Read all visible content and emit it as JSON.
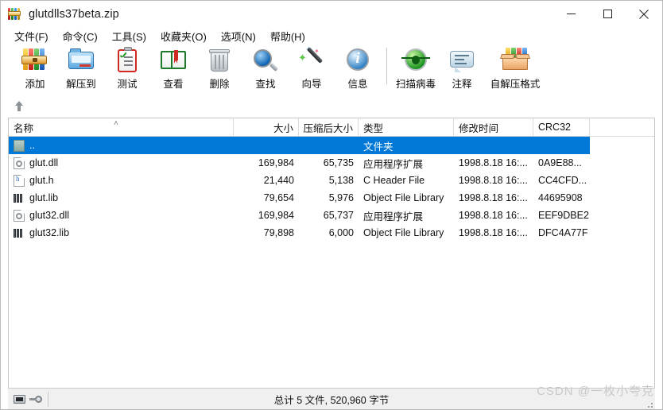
{
  "window": {
    "title": "glutdlls37beta.zip",
    "app_icon": "winrar-books-icon",
    "minimize_label": "─",
    "maximize_label": "□",
    "close_label": "✕"
  },
  "menubar": {
    "items": [
      {
        "label": "文件(F)",
        "name": "menu-file"
      },
      {
        "label": "命令(C)",
        "name": "menu-commands"
      },
      {
        "label": "工具(S)",
        "name": "menu-tools"
      },
      {
        "label": "收藏夹(O)",
        "name": "menu-favorites"
      },
      {
        "label": "选项(N)",
        "name": "menu-options"
      },
      {
        "label": "帮助(H)",
        "name": "menu-help"
      }
    ]
  },
  "toolbar": {
    "buttons": [
      {
        "label": "添加",
        "icon": "archive-add-icon"
      },
      {
        "label": "解压到",
        "icon": "extract-folder-icon"
      },
      {
        "label": "测试",
        "icon": "clipboard-test-icon"
      },
      {
        "label": "查看",
        "icon": "open-book-view-icon"
      },
      {
        "label": "删除",
        "icon": "trash-delete-icon"
      },
      {
        "label": "查找",
        "icon": "magnifier-find-icon"
      },
      {
        "label": "向导",
        "icon": "magic-wand-wizard-icon"
      },
      {
        "label": "信息",
        "icon": "info-circle-icon"
      },
      {
        "label": "扫描病毒",
        "icon": "virus-scan-icon"
      },
      {
        "label": "注释",
        "icon": "comment-bubble-icon"
      },
      {
        "label": "自解压格式",
        "icon": "sfx-box-icon"
      }
    ]
  },
  "navbar": {
    "up_icon": "up-arrow-icon"
  },
  "filelist": {
    "sort_indicator": "˄",
    "columns": [
      {
        "label": "名称",
        "name": "column-name",
        "align": "left"
      },
      {
        "label": "大小",
        "name": "column-size",
        "align": "right"
      },
      {
        "label": "压缩后大小",
        "name": "column-packed-size",
        "align": "right"
      },
      {
        "label": "类型",
        "name": "column-type",
        "align": "left"
      },
      {
        "label": "修改时间",
        "name": "column-modified",
        "align": "left"
      },
      {
        "label": "CRC32",
        "name": "column-crc32",
        "align": "left"
      }
    ],
    "rows": [
      {
        "name": "..",
        "size": "",
        "packed": "",
        "type": "文件夹",
        "modified": "",
        "crc32": "",
        "icon": "parent-folder-icon",
        "selected": true
      },
      {
        "name": "glut.dll",
        "size": "169,984",
        "packed": "65,735",
        "type": "应用程序扩展",
        "modified": "1998.8.18 16:...",
        "crc32": "0A9E88...",
        "icon": "dll-file-icon",
        "selected": false
      },
      {
        "name": "glut.h",
        "size": "21,440",
        "packed": "5,138",
        "type": "C Header File",
        "modified": "1998.8.18 16:...",
        "crc32": "CC4CFD...",
        "icon": "header-file-icon",
        "selected": false
      },
      {
        "name": "glut.lib",
        "size": "79,654",
        "packed": "5,976",
        "type": "Object File Library",
        "modified": "1998.8.18 16:...",
        "crc32": "44695908",
        "icon": "lib-file-icon",
        "selected": false
      },
      {
        "name": "glut32.dll",
        "size": "169,984",
        "packed": "65,737",
        "type": "应用程序扩展",
        "modified": "1998.8.18 16:...",
        "crc32": "EEF9DBE2",
        "icon": "dll-file-icon",
        "selected": false
      },
      {
        "name": "glut32.lib",
        "size": "79,898",
        "packed": "6,000",
        "type": "Object File Library",
        "modified": "1998.8.18 16:...",
        "crc32": "DFC4A77F",
        "icon": "lib-file-icon",
        "selected": false
      }
    ]
  },
  "statusbar": {
    "drive_icon": "drive-icon",
    "key_icon": "key-icon",
    "total_text": "总计 5 文件, 520,960 字节"
  },
  "watermark": {
    "text": "CSDN @一枚小夸克"
  },
  "colors": {
    "selection_blue": "#0078d7",
    "window_bg": "#ffffff",
    "statusbar_bg": "#f0f0f0"
  }
}
